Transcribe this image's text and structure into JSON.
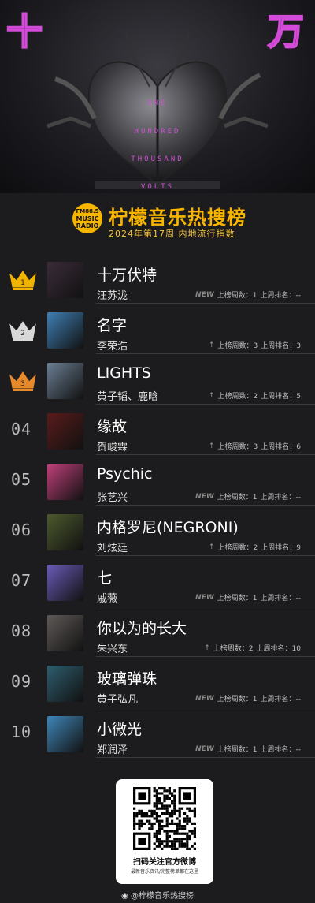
{
  "hero": {
    "char_left": "十",
    "char_right": "万",
    "tagline": [
      "ONE",
      "HUNDRED",
      "THOUSAND",
      "VOLTS"
    ]
  },
  "header": {
    "badge_lines": [
      "FM88.5",
      "MUSIC",
      "RADIO"
    ],
    "title": "柠檬音乐热搜榜",
    "subtitle": "2024年第17周 内地流行指数"
  },
  "chart": [
    {
      "rank": "1",
      "title": "十万伏特",
      "artist": "汪苏泷",
      "trend": "NEW",
      "weeks": "上榜周数：1",
      "last": "上周排名：--",
      "crown": "gold",
      "cover": "#3b2c3a"
    },
    {
      "rank": "2",
      "title": "名字",
      "artist": "李荣浩",
      "trend": "↑",
      "weeks": "上榜周数：3",
      "last": "上周排名：3",
      "crown": "silver",
      "cover": "#3f7fb5"
    },
    {
      "rank": "3",
      "title": "LIGHTS",
      "artist": "黄子韬、鹿晗",
      "trend": "↑",
      "weeks": "上榜周数：2",
      "last": "上周排名：5",
      "crown": "bronze",
      "cover": "#6b7e93"
    },
    {
      "rank": "04",
      "title": "缘故",
      "artist": "贺峻霖",
      "trend": "↑",
      "weeks": "上榜周数：3",
      "last": "上周排名：6",
      "crown": "",
      "cover": "#5a1b1b"
    },
    {
      "rank": "05",
      "title": "Psychic",
      "artist": "张艺兴",
      "trend": "NEW",
      "weeks": "上榜周数：1",
      "last": "上周排名：--",
      "crown": "",
      "cover": "#c0407a"
    },
    {
      "rank": "06",
      "title": "内格罗尼(NEGRONI)",
      "artist": "刘炫廷",
      "trend": "↑",
      "weeks": "上榜周数：2",
      "last": "上周排名：9",
      "crown": "",
      "cover": "#4d5a2e"
    },
    {
      "rank": "07",
      "title": "七",
      "artist": "戚薇",
      "trend": "NEW",
      "weeks": "上榜周数：1",
      "last": "上周排名：--",
      "crown": "",
      "cover": "#6a5bb8"
    },
    {
      "rank": "08",
      "title": "你以为的长大",
      "artist": "朱兴东",
      "trend": "↑",
      "weeks": "上榜周数：2",
      "last": "上周排名：10",
      "crown": "",
      "cover": "#5f5a58"
    },
    {
      "rank": "09",
      "title": "玻璃弹珠",
      "artist": "黄子弘凡",
      "trend": "NEW",
      "weeks": "上榜周数：1",
      "last": "上周排名：--",
      "crown": "",
      "cover": "#2e5d6e"
    },
    {
      "rank": "10",
      "title": "小微光",
      "artist": "郑润泽",
      "trend": "NEW",
      "weeks": "上榜周数：1",
      "last": "上周排名：--",
      "crown": "",
      "cover": "#3f86b8"
    }
  ],
  "qr": {
    "caption": "扫码关注官方微博",
    "subcaption": "最新音乐资讯/完整榜单都在这里"
  },
  "footer": {
    "weibo": "@柠檬音乐热搜榜"
  },
  "colors": {
    "accent": "#f7b500",
    "magenta": "#d14fd7",
    "gold": "#f2b300",
    "silver": "#d8d8d8",
    "bronze": "#e8892a"
  }
}
